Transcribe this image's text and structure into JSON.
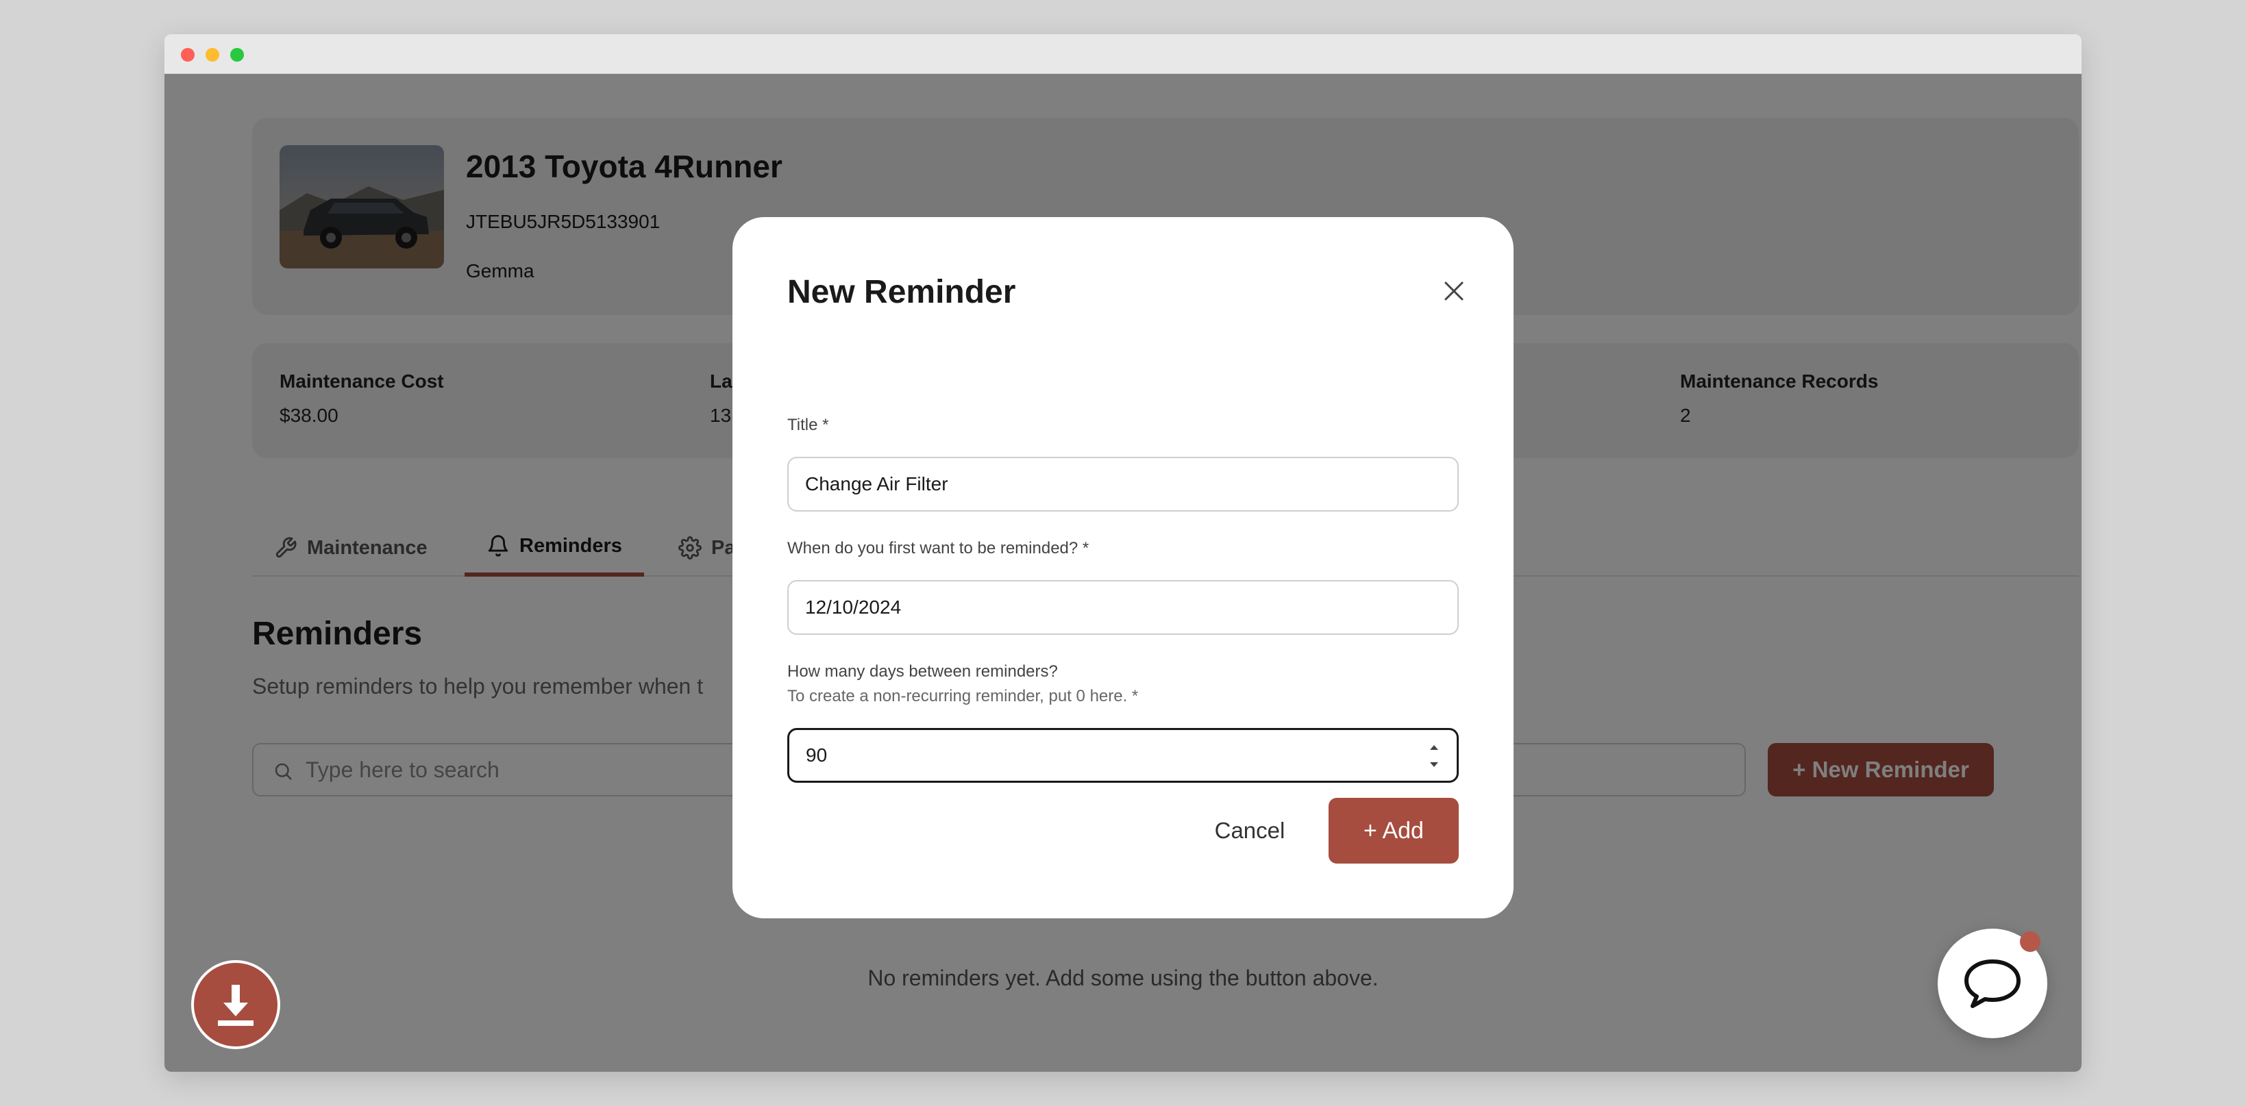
{
  "vehicle": {
    "name": "2013 Toyota 4Runner",
    "vin": "JTEBU5JR5D5133901",
    "owner": "Gemma"
  },
  "stats": [
    {
      "label": "Maintenance Cost",
      "value": "$38.00"
    },
    {
      "label": "La",
      "value": "13("
    },
    {
      "label": "Maintenance Records",
      "value": "2"
    }
  ],
  "tabs": [
    {
      "label": "Maintenance",
      "icon": "wrench-icon"
    },
    {
      "label": "Reminders",
      "icon": "bell-icon",
      "active": true
    },
    {
      "label": "Pa",
      "icon": "gear-icon"
    }
  ],
  "section": {
    "title": "Reminders",
    "subtitle": "Setup reminders to help you remember when t"
  },
  "search": {
    "placeholder": "Type here to search"
  },
  "new_reminder_label": "+ New Reminder",
  "empty_message": "No reminders yet. Add some using the button above.",
  "modal": {
    "title": "New Reminder",
    "title_label": "Title *",
    "title_value": "Change Air Filter",
    "date_label": "When do you first want to be reminded? *",
    "date_value": "12/10/2024",
    "days_label": "How many days between reminders?",
    "days_hint": "To create a non-recurring reminder, put 0 here. *",
    "days_value": "90",
    "cancel_label": "Cancel",
    "add_label": "+ Add"
  },
  "colors": {
    "accent": "#a64d3f",
    "overlay": "rgba(0,0,0,0.5)"
  }
}
